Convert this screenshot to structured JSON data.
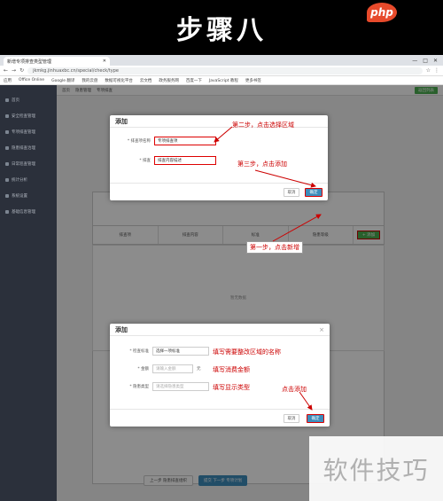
{
  "banner": {
    "title": "步骤八",
    "badge": "php"
  },
  "browser": {
    "tab_title": "新增专项排查类型管理",
    "url": "jkmkg.jinhuaxbc.cn/special/check/type",
    "bookmarks": [
      "应用",
      "Office Online",
      "Google 翻译",
      "我的云盘",
      "数据可视化平台",
      "云文档",
      "政务服务网",
      "百度一下",
      "JavaScript 教程",
      "更多书签"
    ]
  },
  "sidebar": {
    "items": [
      "首页",
      "安全检查管理",
      "专项排查管理",
      "隐患排查治理",
      "日常巡查管理",
      "统计分析",
      "系统设置",
      "基础信息管理"
    ]
  },
  "topbar": {
    "items": [
      "首页",
      "隐患管理",
      "专项排查"
    ],
    "action": "返回列表"
  },
  "table": {
    "headers": [
      "排查项",
      "排查内容",
      "标准",
      "隐患等级",
      "操作"
    ],
    "empty": "暂无数据",
    "add_label": "+ 添加"
  },
  "bottom": {
    "btn1": "上一步 隐患排查组织",
    "btn2": "提交 下一步 专项计划"
  },
  "modal_top": {
    "title": "添加",
    "field1_label": "* 排查项名称",
    "field1_value": "专项排查项",
    "field2_label": "* 排查",
    "field2_value": "排查内容描述",
    "cancel": "取消",
    "ok": "确定"
  },
  "modal_bottom": {
    "title": "添加",
    "field1_label": "* 检查标准",
    "field1_value": "选择一项标准",
    "field2_label": "* 金额",
    "field2_placeholder": "请输入金额",
    "field2_unit": "元",
    "field3_label": "* 隐患类型",
    "field3_placeholder": "请选择隐患类型",
    "cancel": "取消",
    "ok": "确定"
  },
  "notes": {
    "step1": "第一步，点击新增",
    "step2": "第二步，点击选择区域",
    "step3": "第三步，点击添加",
    "fill1": "填写需要整改区域的名称",
    "fill2": "填写消费金额",
    "fill3": "填写显示类型",
    "click_add": "点击添加"
  },
  "watermark": "软件技巧",
  "colors": {
    "accent": "#3c8dbc",
    "annotation": "#cc0000",
    "add_green": "#4caf50",
    "sidebar": "#2b303b"
  }
}
